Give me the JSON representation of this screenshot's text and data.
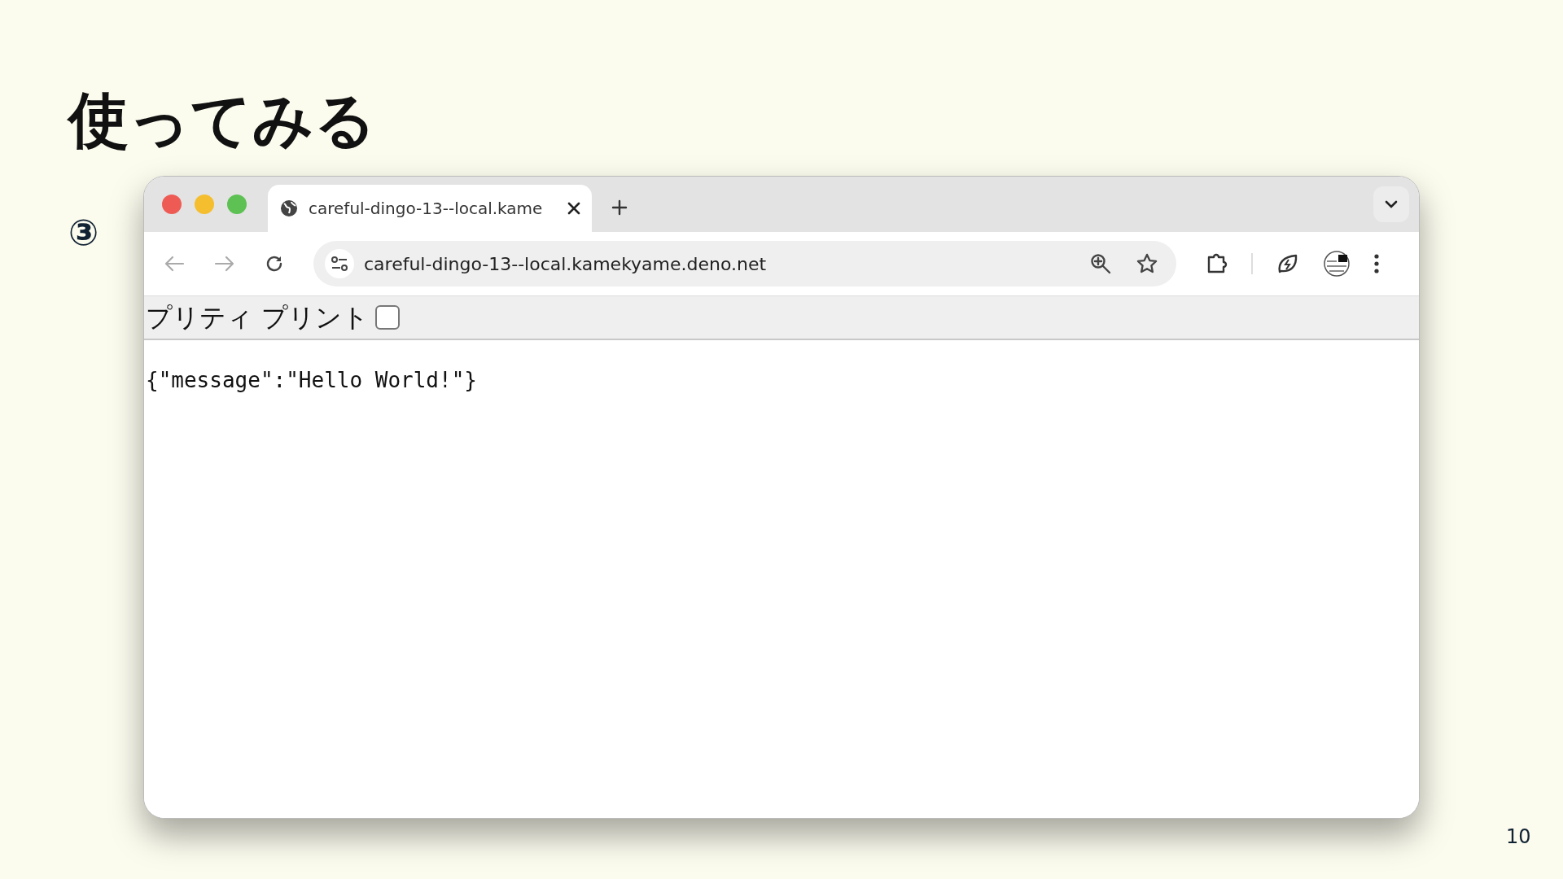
{
  "slide": {
    "title": "使ってみる",
    "step_marker": "③",
    "page_number": "10"
  },
  "browser": {
    "tabs": [
      {
        "title": "careful-dingo-13--local.kame",
        "selected": true
      }
    ],
    "address": "careful-dingo-13--local.kamekyame.deno.net"
  },
  "page": {
    "pretty_print": {
      "label": "プリティ プリント",
      "checked": false
    },
    "body": "{\"message\":\"Hello World!\"}"
  }
}
